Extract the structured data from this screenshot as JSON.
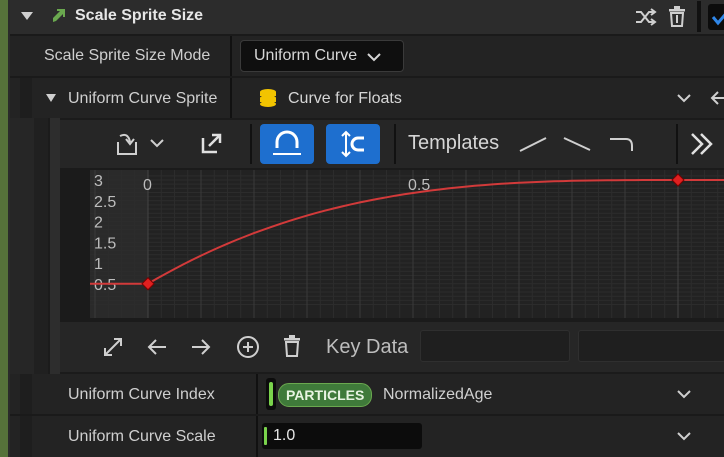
{
  "section": {
    "title": "Scale Sprite Size",
    "enabled": true
  },
  "mode_row": {
    "label": "Scale Sprite Size Mode",
    "value": "Uniform Curve"
  },
  "curve_sprite_row": {
    "label": "Uniform Curve Sprite",
    "asset_value": "Curve for Floats"
  },
  "curve_toolbar": {
    "templates_label": "Templates"
  },
  "curve_editor": {
    "y_ticks": [
      "3",
      "2.5",
      "2",
      "1.5",
      "1",
      "0.5"
    ],
    "x_ticks": [
      "0",
      "0.5"
    ],
    "keys": [
      {
        "time": 0,
        "value": 0.5
      },
      {
        "time": 1,
        "value": 3
      }
    ],
    "key_data_label": "Key Data"
  },
  "index_row": {
    "label": "Uniform Curve Index",
    "badge": "PARTICLES",
    "value": "NormalizedAge"
  },
  "scale_row": {
    "label": "Uniform Curve Scale",
    "value": "1.0"
  },
  "colors": {
    "accent_blue": "#1e6fcf",
    "curve_red": "#d23a3a",
    "badge_green": "#3f7a3a"
  }
}
